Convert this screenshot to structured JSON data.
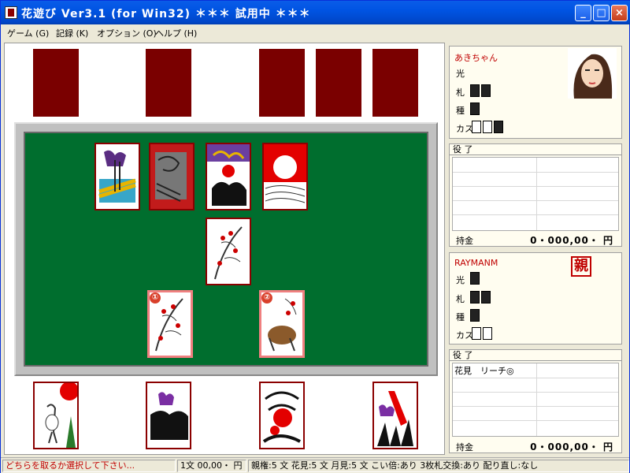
{
  "window": {
    "title": "花遊び Ver3.1 (for Win32)   ＊＊＊ 試用中 ＊＊＊"
  },
  "menu": {
    "items": [
      "ゲーム (G)",
      "記録 (K)",
      "オプション (O)",
      "ヘルプ (H)"
    ]
  },
  "opponent": {
    "name": "あきちゃん",
    "rows": [
      "光",
      "札",
      "種",
      "カス"
    ],
    "yaku_header": "役 了",
    "money_label": "持金",
    "money_value": "0・000,00・ 円"
  },
  "player": {
    "name": "RAYMANM",
    "dealer_mark": "親",
    "rows": [
      "光",
      "札",
      "種",
      "カス"
    ],
    "yaku_header": "役 了",
    "yaku_entry": "花見　リーチ◎",
    "money_label": "持金",
    "money_value": "0・000,00・ 円"
  },
  "choices": {
    "first": "①",
    "second": "②"
  },
  "status": {
    "message": "どちらを取るか選択して下さい...",
    "mon": "1文 00,00・ 円",
    "rules": "親権:5 文  花見:5 文  月見:5 文  こい倍:あり  3枚札交換:あり  配り直し:なし"
  },
  "colors": {
    "felt": "#006e2e",
    "card_back": "#7a0000",
    "accent_red": "#c00000"
  }
}
